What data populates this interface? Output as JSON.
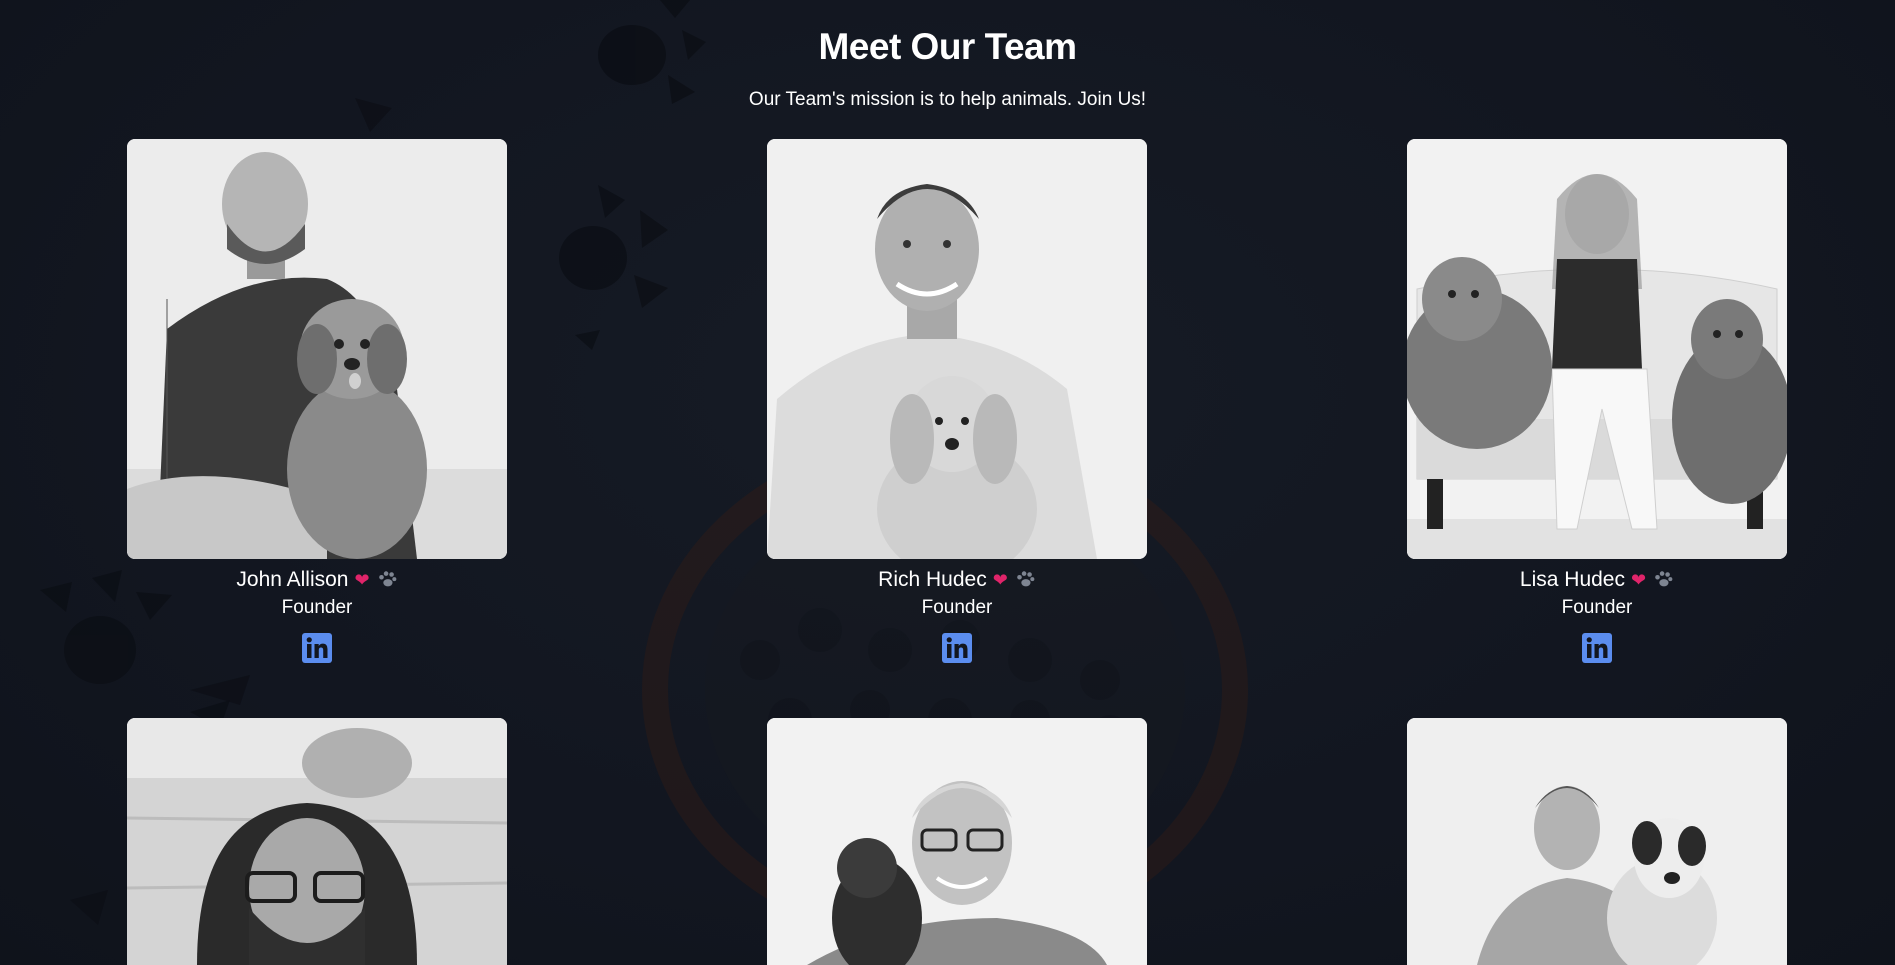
{
  "header": {
    "title": "Meet Our Team",
    "subtitle": "Our Team's mission is to help animals. Join Us!"
  },
  "colors": {
    "background": "#131822",
    "heart": "#e0246a",
    "linkedin": "#5b8def"
  },
  "team": [
    {
      "name": "John Allison",
      "role": "Founder",
      "icons": [
        "heart-icon",
        "paw-icon",
        "linkedin-icon"
      ]
    },
    {
      "name": "Rich Hudec",
      "role": "Founder",
      "icons": [
        "heart-icon",
        "paw-icon",
        "linkedin-icon"
      ]
    },
    {
      "name": "Lisa Hudec",
      "role": "Founder",
      "icons": [
        "heart-icon",
        "paw-icon",
        "linkedin-icon"
      ]
    },
    {
      "name": "",
      "role": ""
    },
    {
      "name": "",
      "role": ""
    },
    {
      "name": "",
      "role": ""
    }
  ]
}
